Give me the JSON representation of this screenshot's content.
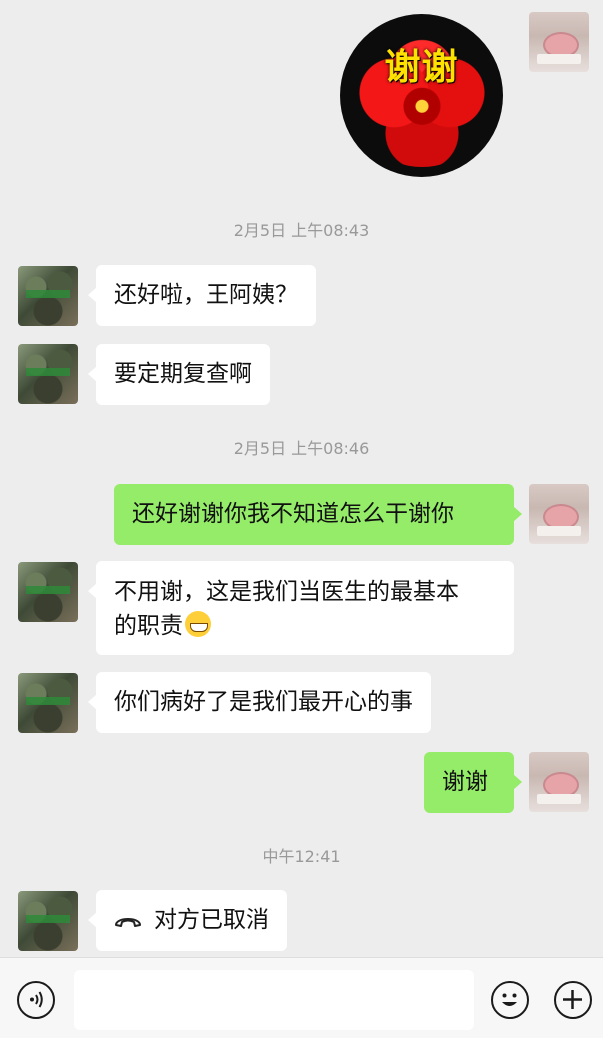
{
  "sticker": {
    "text": "谢谢"
  },
  "messages": [
    {
      "id": "t1",
      "type": "time",
      "text": "2月5日 上午08:43"
    },
    {
      "id": "m1",
      "side": "left",
      "text": "还好啦，王阿姨？"
    },
    {
      "id": "m2",
      "side": "left",
      "text": "要定期复查啊"
    },
    {
      "id": "t2",
      "type": "time",
      "text": "2月5日 上午08:46"
    },
    {
      "id": "m3",
      "side": "right",
      "text": "还好谢谢你我不知道怎么干谢你"
    },
    {
      "id": "m4",
      "side": "left",
      "text": "不用谢，这是我们当医生的最基本的职责"
    },
    {
      "id": "m5",
      "side": "left",
      "text": "你们病好了是我们最开心的事"
    },
    {
      "id": "m6",
      "side": "right",
      "text": "谢谢"
    },
    {
      "id": "t3",
      "type": "time",
      "text": "中午12:41"
    },
    {
      "id": "m7",
      "side": "left",
      "type": "call",
      "text": "对方已取消"
    }
  ],
  "m4_line1": "不用谢，这是我们当医生的最基本",
  "m4_line2": "的职责",
  "icons": {
    "voice": "voice-icon",
    "emoji": "emoji-icon",
    "plus": "plus-icon",
    "call": "phone-hangup-icon",
    "grin": "grin-emoji-icon"
  },
  "colors": {
    "background": "#ededed",
    "bubble_self": "#95ec69",
    "bubble_other": "#ffffff",
    "time": "#999999"
  }
}
